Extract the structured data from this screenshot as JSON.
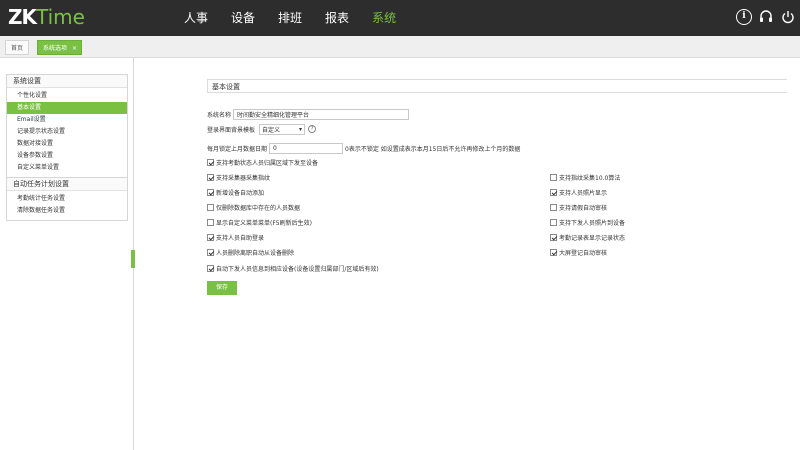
{
  "brand": {
    "zk": "ZK",
    "time": "Time"
  },
  "nav": [
    "人事",
    "设备",
    "排班",
    "报表",
    "系统"
  ],
  "nav_active": 4,
  "tabs": {
    "home": "首页",
    "system": "系统选项",
    "close": "×"
  },
  "sidebar": {
    "groups": [
      {
        "title": "系统设置",
        "items": [
          "个性化设置",
          "基本设置",
          "Email设置",
          "记录提示状态设置",
          "数据对接设置",
          "设备参数设置",
          "自定义菜单设置"
        ],
        "active": 1
      },
      {
        "title": "自动任务计划设置",
        "items": [
          "考勤统计任务设置",
          "清除数据任务设置"
        ],
        "active": -1
      }
    ]
  },
  "panel_title": "基本设置",
  "form": {
    "system_name_label": "系统名称",
    "system_name_value": "时间勤安全精细化管理平台",
    "login_bg_label": "登录界面背景模板",
    "login_bg_value": "自定义",
    "lock_label": "每月锁定上月数据日期",
    "lock_value": "0",
    "lock_hint": "0表示不锁定  如设置成表示本月15日后不允许再修改上个月的数据",
    "checkboxes_left": [
      {
        "label": "支持考勤状态人员归属区域下发至设备",
        "checked": true
      },
      {
        "label": "支持采集器采集指纹",
        "checked": true
      },
      {
        "label": "新增设备自动添加",
        "checked": true
      },
      {
        "label": "仅删除数据库中存在的人员数据",
        "checked": false
      },
      {
        "label": "显示自定义菜单菜单(F5刷新后生效)",
        "checked": false
      },
      {
        "label": "支持人员自助登录",
        "checked": true
      },
      {
        "label": "人员删除离职自动从设备删除",
        "checked": true
      },
      {
        "label": "自动下发人员信息到相应设备(设备设置归属部门/区域后有效)",
        "checked": true
      }
    ],
    "checkboxes_right": [
      {
        "label": "支持指纹采集10.0算法",
        "checked": false
      },
      {
        "label": "支持人员照片显示",
        "checked": true
      },
      {
        "label": "支持请假自动审核",
        "checked": false
      },
      {
        "label": "支持下发人员照片到设备",
        "checked": false
      },
      {
        "label": "考勤记录表显示记录状态",
        "checked": true
      },
      {
        "label": "大屏登记自动审核",
        "checked": true
      }
    ],
    "save_label": "保存"
  }
}
